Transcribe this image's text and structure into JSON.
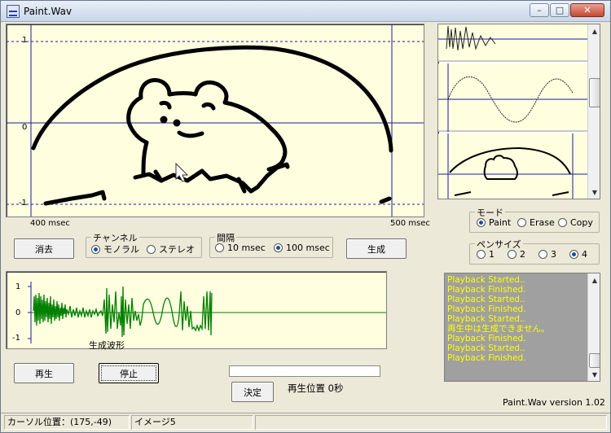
{
  "window": {
    "title": "Paint.Wav"
  },
  "titlebar_buttons": {
    "minimize": "–",
    "maximize": "□",
    "close": "✕"
  },
  "canvas": {
    "y_ticks": [
      "1",
      "0",
      "-1"
    ],
    "x_start_label": "400 msec",
    "x_end_label": "500 msec"
  },
  "buttons": {
    "clear": "消去",
    "generate": "生成",
    "play": "再生",
    "stop": "停止",
    "decide": "決定"
  },
  "channel": {
    "title": "チャンネル",
    "options": [
      "モノラル",
      "ステレオ"
    ],
    "selected": "モノラル"
  },
  "interval": {
    "title": "間隔",
    "options": [
      "10 msec",
      "100 msec"
    ],
    "selected": "100 msec"
  },
  "mode": {
    "title": "モード",
    "options": [
      "Paint",
      "Erase",
      "Copy"
    ],
    "selected": "Paint"
  },
  "pen_size": {
    "title": "ペンサイズ",
    "options": [
      "1",
      "2",
      "3",
      "4"
    ],
    "selected": "4"
  },
  "waveform": {
    "y_ticks": [
      "1",
      "0",
      "-1"
    ],
    "label": "生成波形"
  },
  "log": {
    "lines": [
      "Playback Started..",
      "Playback Finished.",
      "Playback Started..",
      "Playback Finished.",
      "Playback Started..",
      "再生中は生成できません。",
      "Playback Finished.",
      "Playback Started..",
      "Playback Finished."
    ]
  },
  "playback": {
    "position_label": "再生位置 0秒",
    "progress": 0
  },
  "version": "Paint.Wav version 1.02",
  "status": {
    "cursor": "カーソル位置：(175,-49)",
    "image": "イメージ5"
  },
  "colors": {
    "canvas_bg": "#ffffe0",
    "axis": "#1a1aa0",
    "wave": "#008000",
    "log_text": "#ffff00",
    "log_bg": "#a0a0a0"
  }
}
